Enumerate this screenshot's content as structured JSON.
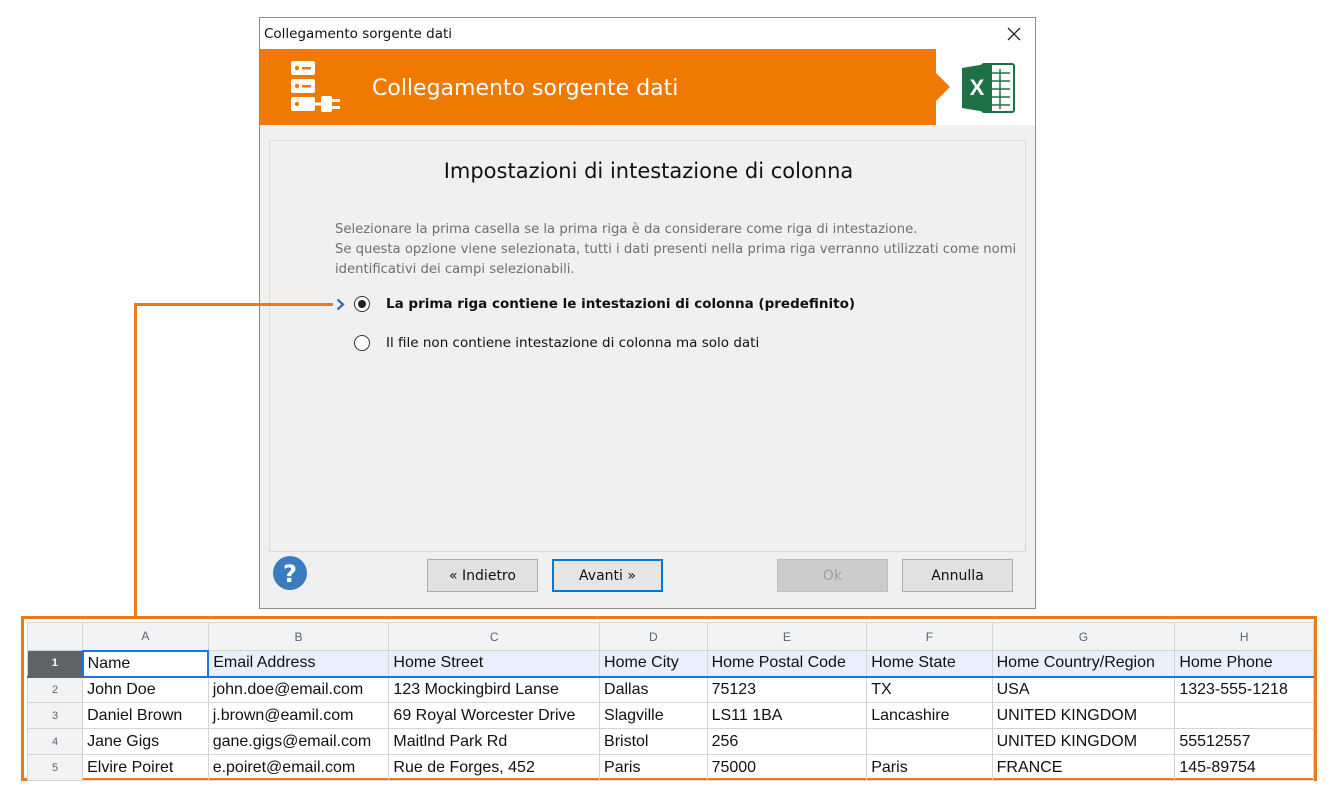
{
  "dialog": {
    "window_title": "Collegamento sorgente dati",
    "banner_title": "Collegamento sorgente dati",
    "heading": "Impostazioni di intestazione di colonna",
    "description": [
      "Selezionare la prima casella se la prima riga è da considerare come riga di intestazione.",
      "Se questa opzione viene selezionata, tutti i dati presenti nella prima riga verranno utilizzati come nomi",
      "identificativi dei campi selezionabili."
    ],
    "options": [
      {
        "label": "La prima riga contiene le intestazioni di colonna (predefinito)",
        "selected": true
      },
      {
        "label": "Il file non contiene intestazione di colonna ma solo dati",
        "selected": false
      }
    ],
    "buttons": {
      "back": "« Indietro",
      "next": "Avanti »",
      "ok": "Ok",
      "cancel": "Annulla"
    },
    "colors": {
      "banner": "#f07902",
      "excel_green": "#1e7145",
      "help_blue": "#3b7bbf",
      "accent_line": "#e97a1e"
    }
  },
  "spreadsheet": {
    "column_letters": [
      "A",
      "B",
      "C",
      "D",
      "E",
      "F",
      "G",
      "H"
    ],
    "rows": [
      {
        "num": "1",
        "cells": [
          "Name",
          "Email Address",
          "Home Street",
          "Home City",
          "Home Postal Code",
          "Home State",
          "Home Country/Region",
          "Home Phone"
        ]
      },
      {
        "num": "2",
        "cells": [
          "John Doe",
          "john.doe@email.com",
          "123 Mockingbird Lanse",
          "Dallas",
          "75123",
          "TX",
          "USA",
          "1323-555-1218"
        ]
      },
      {
        "num": "3",
        "cells": [
          "Daniel Brown",
          "j.brown@eamil.com",
          "69 Royal Worcester Drive",
          "Slagville",
          "LS11 1BA",
          "Lancashire",
          "UNITED KINGDOM",
          ""
        ]
      },
      {
        "num": "4",
        "cells": [
          "Jane Gigs",
          "gane.gigs@email.com",
          "Maitlnd Park Rd",
          "Bristol",
          "256",
          "",
          "UNITED KINGDOM",
          "55512557"
        ]
      },
      {
        "num": "5",
        "cells": [
          "Elvire Poiret",
          "e.poiret@email.com",
          "Rue de Forges, 452",
          "Paris",
          "75000",
          "Paris",
          "FRANCE",
          "145-89754"
        ]
      }
    ]
  }
}
